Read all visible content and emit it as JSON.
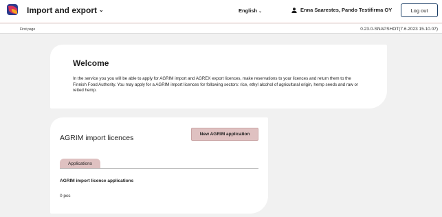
{
  "header": {
    "app_title": "Import and export",
    "language": "English",
    "user": "Enna Saarestes, Pando Testifirma OY",
    "logout_label": "Log out"
  },
  "subheader": {
    "breadcrumb": "First page",
    "version": "0.23.0-SNAPSHOT(7.6.2023 15.10.07)"
  },
  "welcome": {
    "title": "Welcome",
    "body": "In the service you you will be able to apply for AGRIM import and AGREX export licences, make reservations to your licences and return them to the Finnish Food Authority. You may apply for a AGRIM import licences for following sectors: rice, ethyl alcohol of agricultural origin, hemp seeds and raw or retted hemp."
  },
  "agrim": {
    "title": "AGRIM import licences",
    "new_button": "New AGRIM application",
    "tab_label": "Applications",
    "section_title": "AGRIM import licence applications",
    "count": "0 pcs"
  },
  "icons": {
    "logo": "app-logo",
    "user": "user-icon",
    "chevron": "chevron-down-icon"
  },
  "colors": {
    "accent": "#dfc1c1",
    "logout_border": "#1a3e66",
    "background": "#f1f1f1"
  }
}
